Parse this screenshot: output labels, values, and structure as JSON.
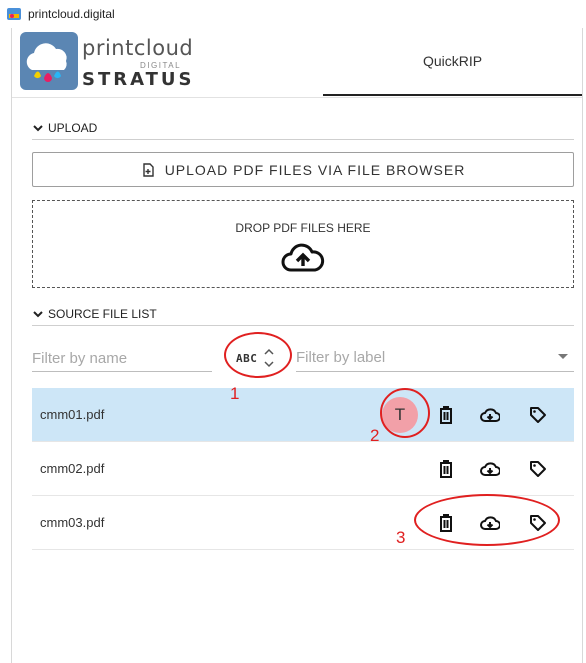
{
  "window": {
    "title": "printcloud.digital"
  },
  "logo": {
    "brand_main": "printcloud",
    "brand_sub": "DIGITAL",
    "brand_product": "STRATUS"
  },
  "tabs": [
    {
      "label": "QuickRIP",
      "active": true
    }
  ],
  "upload_section": {
    "header": "UPLOAD",
    "button_label": "UPLOAD PDF FILES VIA FILE BROWSER",
    "drop_label": "DROP PDF FILES HERE"
  },
  "source_section": {
    "header": "SOURCE FILE LIST",
    "filter_name_placeholder": "Filter by name",
    "sort_label": "ABC",
    "filter_label_placeholder": "Filter by label"
  },
  "files": [
    {
      "name": "cmm01.pdf",
      "selected": true,
      "template_badge": "T"
    },
    {
      "name": "cmm02.pdf",
      "selected": false
    },
    {
      "name": "cmm03.pdf",
      "selected": false
    }
  ],
  "annotations": {
    "n1": "1",
    "n2": "2",
    "n3": "3",
    "color": "#e02020"
  },
  "colors": {
    "selected_row": "#cde6f7",
    "badge_bg": "#f2a0a8"
  },
  "icons": {
    "file_add": "file-add-icon",
    "cloud_upload": "cloud-upload-icon",
    "delete": "trash-icon",
    "cloud_download": "cloud-download-icon",
    "label": "tag-icon",
    "chevron": "chevron-down-icon",
    "sort": "sort-arrows-icon"
  }
}
